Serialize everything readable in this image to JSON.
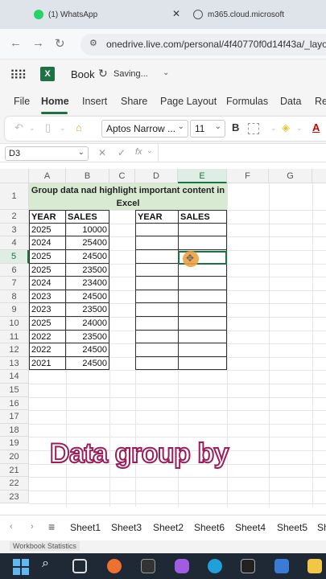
{
  "browser": {
    "tabs": [
      {
        "title": "(1) WhatsApp",
        "close": "✕"
      },
      {
        "title": "m365.cloud.microsoft"
      }
    ],
    "url": "onedrive.live.com/personal/4f40770f0d14f43a/_layouts/"
  },
  "excel": {
    "file_name": "Book",
    "save_status": "Saving...",
    "ribbon_tabs": [
      "File",
      "Home",
      "Insert",
      "Share",
      "Page Layout",
      "Formulas",
      "Data",
      "Re"
    ],
    "font_name": "Aptos Narrow ...",
    "font_size": "11",
    "name_box": "D3",
    "fx": "fx"
  },
  "grid": {
    "columns": [
      "A",
      "B",
      "C",
      "D",
      "E",
      "F",
      "G"
    ],
    "rows": [
      "1",
      "2",
      "3",
      "4",
      "5",
      "6",
      "7",
      "8",
      "9",
      "10",
      "11",
      "12",
      "13",
      "14",
      "15",
      "16",
      "17",
      "18",
      "19",
      "20",
      "21",
      "22",
      "23"
    ],
    "title": "Group data nad highlight important content in Excel",
    "headers": {
      "a": "YEAR",
      "b": "SALES",
      "d": "YEAR",
      "e": "SALES"
    },
    "data": [
      {
        "year": "2025",
        "sales": "10000"
      },
      {
        "year": "2024",
        "sales": "25400"
      },
      {
        "year": "2025",
        "sales": "24500"
      },
      {
        "year": "2025",
        "sales": "23500"
      },
      {
        "year": "2024",
        "sales": "23400"
      },
      {
        "year": "2023",
        "sales": "24500"
      },
      {
        "year": "2023",
        "sales": "23500"
      },
      {
        "year": "2025",
        "sales": "24000"
      },
      {
        "year": "2022",
        "sales": "23500"
      },
      {
        "year": "2022",
        "sales": "24500"
      },
      {
        "year": "2021",
        "sales": "24500"
      }
    ]
  },
  "overlay_text": "Data group by",
  "sheets": [
    "Sheet1",
    "Sheet3",
    "Sheet2",
    "Sheet6",
    "Sheet4",
    "Sheet5",
    "Sh"
  ],
  "status": "Workbook Statistics",
  "colors": {
    "accent": "#1e7145",
    "title_fill": "#d9ead3",
    "overlay_stroke": "#9c1d5a"
  }
}
